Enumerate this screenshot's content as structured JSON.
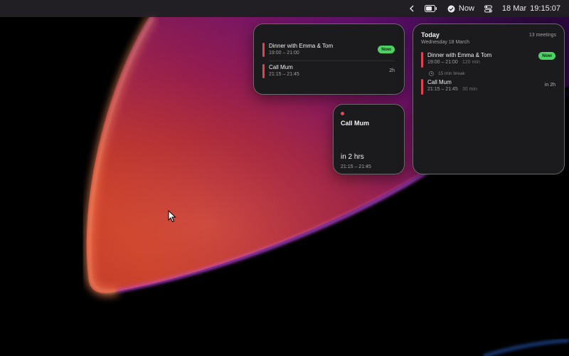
{
  "menubar": {
    "now_label": "Now",
    "date": "18 Mar",
    "time": "19:15:07"
  },
  "widget_list": {
    "events": [
      {
        "title": "Dinner with Emma & Tom",
        "time": "19:00 – 21:00",
        "badge": "Now"
      },
      {
        "title": "Call Mum",
        "time": "21:15 – 21:45",
        "right": "2h"
      }
    ]
  },
  "widget_next": {
    "title": "Call Mum",
    "in_text": "in 2 hrs",
    "time": "21:15 – 21:45"
  },
  "widget_today": {
    "title": "Today",
    "date": "Wednesday 18 March",
    "count": "13 meetings",
    "events": [
      {
        "title": "Dinner with Emma & Tom",
        "time": "19:00 – 21:00",
        "duration": "120 min",
        "badge": "Now"
      },
      {
        "title": "Call Mum",
        "time": "21:15 – 21:45",
        "duration": "30 min",
        "right": "in 2h"
      }
    ],
    "break_label": "15 min break"
  },
  "colors": {
    "event_bar": "#e5414f",
    "now_badge": "#4ed164"
  }
}
